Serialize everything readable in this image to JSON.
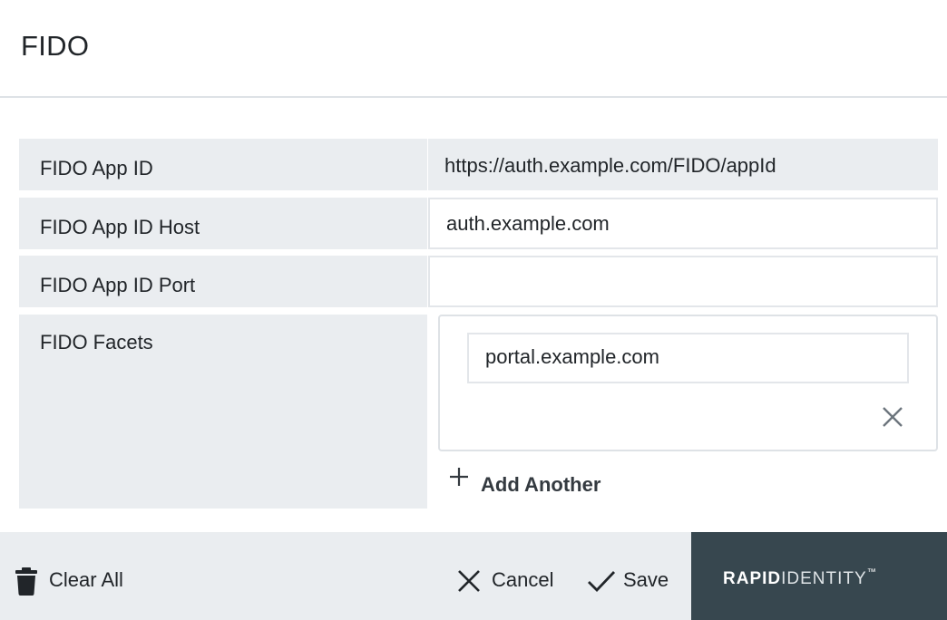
{
  "header": {
    "title": "FIDO"
  },
  "fields": {
    "app_id": {
      "label": "FIDO App ID",
      "value": "https://auth.example.com/FIDO/appId"
    },
    "app_id_host": {
      "label": "FIDO App ID Host",
      "value": "auth.example.com"
    },
    "app_id_port": {
      "label": "FIDO App ID Port",
      "value": ""
    },
    "facets": {
      "label": "FIDO Facets",
      "items": [
        {
          "value": "portal.example.com"
        }
      ],
      "add_label": "Add Another"
    }
  },
  "footer": {
    "clear_all_label": "Clear All",
    "cancel_label": "Cancel",
    "save_label": "Save"
  },
  "brand": {
    "part1": "RAPID",
    "part2": "IDENTITY",
    "tm": "™",
    "bg_color": "#37474f"
  },
  "icons": {
    "clear_all": "trash-icon",
    "cancel": "close-icon",
    "save": "check-icon",
    "facet_remove": "close-icon",
    "add": "plus-icon"
  }
}
